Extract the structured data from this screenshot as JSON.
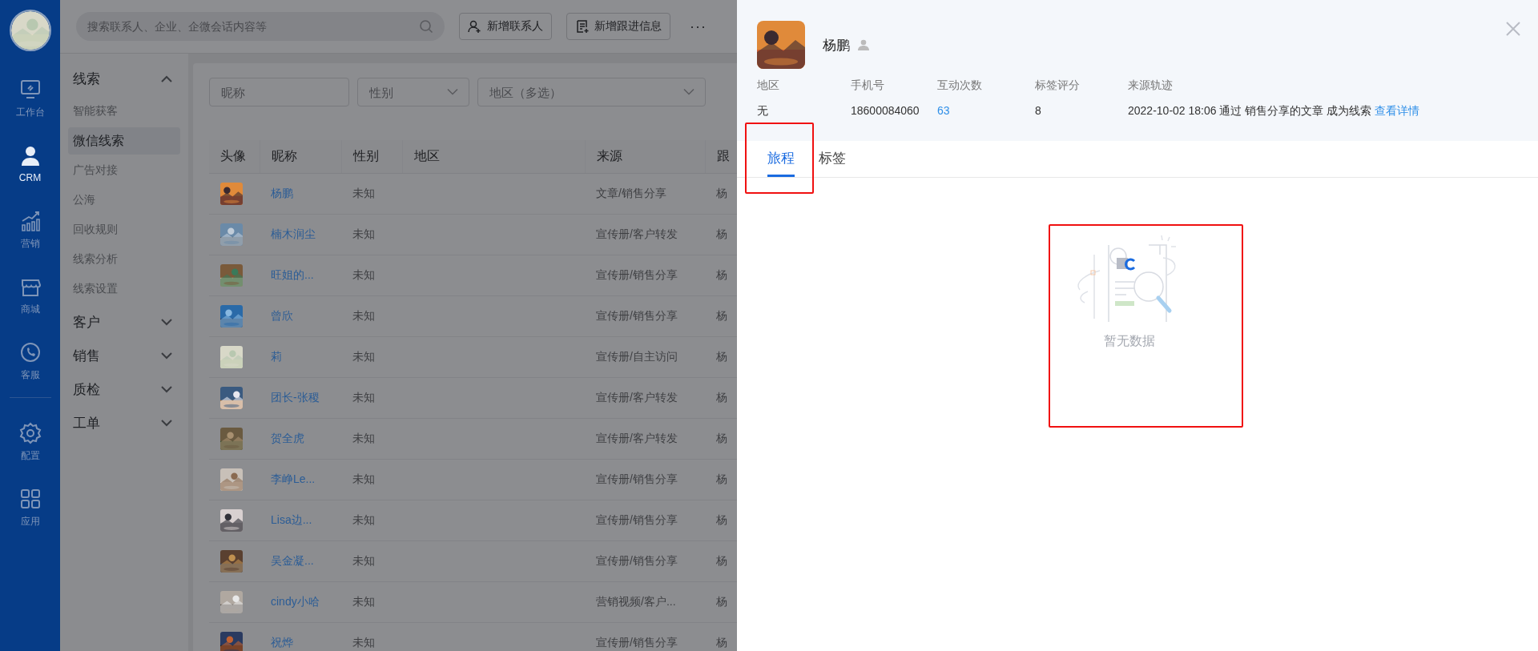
{
  "rail": {
    "items": [
      {
        "label": "工作台",
        "kind": "monitor",
        "selected": false
      },
      {
        "label": "CRM",
        "kind": "person",
        "selected": true
      },
      {
        "label": "营销",
        "kind": "chart",
        "selected": false
      },
      {
        "label": "商城",
        "kind": "shop",
        "selected": false
      },
      {
        "label": "客服",
        "kind": "phone",
        "selected": false
      },
      {
        "label": "配置",
        "kind": "gear",
        "selected": false
      },
      {
        "label": "应用",
        "kind": "grid",
        "selected": false
      }
    ]
  },
  "topbar": {
    "search": {
      "placeholder": "搜索联系人、企业、企微会话内容等"
    },
    "buttons": [
      {
        "label": "新增联系人",
        "kind": "add-person"
      },
      {
        "label": "新增跟进信息",
        "kind": "note"
      }
    ],
    "more": "···"
  },
  "nav": {
    "groups": [
      {
        "label": "线索",
        "expanded": true,
        "children": [
          {
            "label": "智能获客",
            "selected": false
          },
          {
            "label": "微信线索",
            "selected": true
          },
          {
            "label": "广告对接",
            "selected": false
          },
          {
            "label": "公海",
            "selected": false
          },
          {
            "label": "回收规则",
            "selected": false
          },
          {
            "label": "线索分析",
            "selected": false
          },
          {
            "label": "线索设置",
            "selected": false
          }
        ]
      },
      {
        "label": "客户",
        "expanded": false
      },
      {
        "label": "销售",
        "expanded": false
      },
      {
        "label": "质检",
        "expanded": false
      },
      {
        "label": "工单",
        "expanded": false
      }
    ]
  },
  "filters": [
    {
      "placeholder": "昵称",
      "kind": "text"
    },
    {
      "placeholder": "性别",
      "kind": "select"
    },
    {
      "placeholder": "地区（多选）",
      "kind": "select"
    }
  ],
  "table": {
    "columns": [
      "头像",
      "昵称",
      "性别",
      "地区",
      "来源",
      "跟"
    ],
    "rows": [
      {
        "nickname": "杨鹏",
        "gender": "未知",
        "source": "文章/销售分享",
        "column_6": "杨"
      },
      {
        "nickname": "楠木润尘",
        "gender": "未知",
        "source": "宣传册/客户转发",
        "column_6": "杨"
      },
      {
        "nickname": "旺姐的...",
        "gender": "未知",
        "source": "宣传册/销售分享",
        "column_6": "杨"
      },
      {
        "nickname": "曾欣",
        "gender": "未知",
        "source": "宣传册/销售分享",
        "column_6": "杨"
      },
      {
        "nickname": "莉",
        "gender": "未知",
        "source": "宣传册/自主访问",
        "column_6": "杨"
      },
      {
        "nickname": "团长-张稷",
        "gender": "未知",
        "source": "宣传册/客户转发",
        "column_6": "杨"
      },
      {
        "nickname": "贺全虎",
        "gender": "未知",
        "source": "宣传册/客户转发",
        "column_6": "杨"
      },
      {
        "nickname": "李峥Le...",
        "gender": "未知",
        "source": "宣传册/销售分享",
        "column_6": "杨"
      },
      {
        "nickname": "Lisa边...",
        "gender": "未知",
        "source": "宣传册/销售分享",
        "column_6": "杨"
      },
      {
        "nickname": "吴金凝...",
        "gender": "未知",
        "source": "宣传册/销售分享",
        "column_6": "杨"
      },
      {
        "nickname": "cindy小哈",
        "gender": "未知",
        "source": "营销视频/客户...",
        "column_6": "杨"
      },
      {
        "nickname": "祝烨",
        "gender": "未知",
        "source": "宣传册/销售分享",
        "column_6": "杨"
      }
    ]
  },
  "drawer": {
    "name": "杨鹏",
    "fields": [
      {
        "label": "地区",
        "value": "无",
        "kind": "plain"
      },
      {
        "label": "手机号",
        "value": "18600084060",
        "kind": "plain"
      },
      {
        "label": "互动次数",
        "value": "63",
        "kind": "link"
      },
      {
        "label": "标签评分",
        "value": "8",
        "kind": "plain"
      },
      {
        "label": "来源轨迹",
        "value": "2022-10-02 18:06 通过 销售分享的文章 成为线索",
        "link": "查看详情",
        "kind": "trace"
      }
    ],
    "tabs": [
      {
        "label": "旅程",
        "selected": true
      },
      {
        "label": "标签",
        "selected": false
      }
    ],
    "empty_text": "暂无数据"
  }
}
